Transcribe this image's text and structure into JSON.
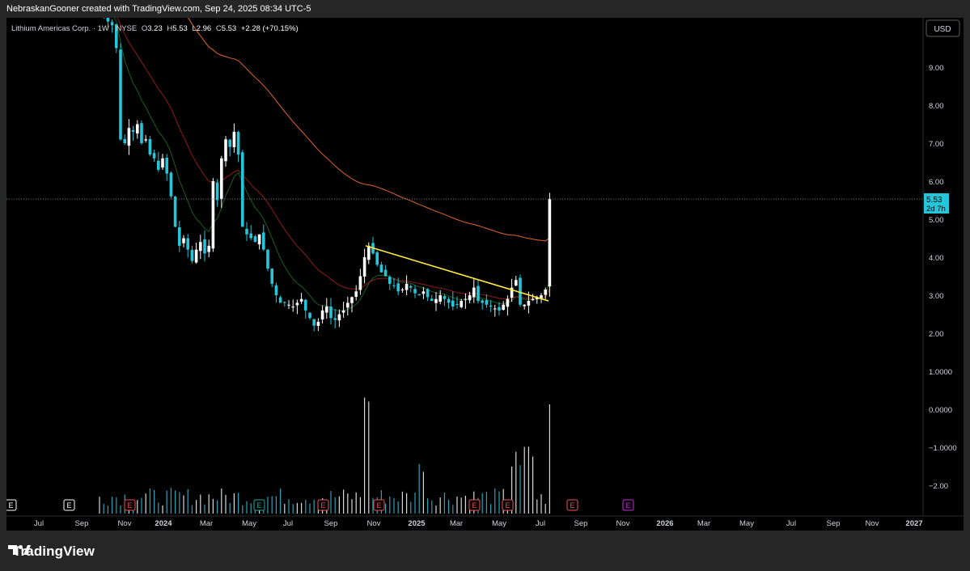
{
  "header": {
    "credit": "NebraskanGooner created with TradingView.com, Sep 24, 2025 08:34 UTC-5"
  },
  "legend": {
    "symbol": "Lithium Americas Corp. · 1W · NYSE",
    "o_label": "O",
    "o_value": "3.23",
    "h_label": "H",
    "h_value": "5.53",
    "l_label": "L",
    "l_value": "2.96",
    "c_label": "C",
    "c_value": "5.53",
    "change": "+2.28 (+70.15%)"
  },
  "currency_button": "USD",
  "price_axis_labels": [
    "9.00",
    "8.00",
    "7.00",
    "6.00",
    "5.00",
    "4.00",
    "3.00",
    "2.00",
    "1.0000",
    "0.0000",
    "−1.0000",
    "−2.00"
  ],
  "last_price": {
    "value": "5.53",
    "countdown": "2d 7h"
  },
  "time_axis_labels": [
    "Jul",
    "Sep",
    "Nov",
    "2024",
    "Mar",
    "May",
    "Jul",
    "Sep",
    "Nov",
    "2025",
    "Mar",
    "May",
    "Jul",
    "Sep",
    "Nov",
    "2026",
    "Mar",
    "May",
    "Jul",
    "Sep",
    "Nov",
    "2027"
  ],
  "earnings_marker_label": "E",
  "dividend_marker_label": "E",
  "brand": {
    "name": "TradingView"
  },
  "colors": {
    "background": "#000000",
    "up_candle": "#ffffff",
    "down_candle": "#26c6da",
    "ema_fast": "#1b5e20",
    "ema_mid": "#8e1b1b",
    "sma_slow": "#e0652a",
    "trendline": "#ffeb3b",
    "earnings": "#ef5350",
    "earnings_green": "#26a69a",
    "future_event": "#c62ad6",
    "volume": "#2aa0b8"
  },
  "chart_data": {
    "type": "candlestick",
    "interval": "1W",
    "price_range": [
      -2.6,
      10.4
    ],
    "x_labels": [
      "Jul",
      "Sep",
      "Nov",
      "2024",
      "Mar",
      "May",
      "Jul",
      "Sep",
      "Nov",
      "2025",
      "Mar",
      "May",
      "Jul",
      "Sep",
      "Nov",
      "2026",
      "Mar",
      "May",
      "Jul",
      "Sep",
      "Nov",
      "2027"
    ],
    "closes": [
      10.5,
      10.4,
      10.2,
      10.1,
      9.5,
      7.1,
      7.0,
      7.4,
      7.3,
      7.5,
      7.0,
      7.1,
      6.7,
      6.6,
      6.3,
      6.6,
      6.2,
      5.6,
      4.8,
      4.3,
      4.5,
      4.2,
      3.9,
      4.2,
      4.4,
      4.1,
      4.3,
      6.0,
      5.5,
      6.6,
      7.1,
      6.9,
      7.3,
      6.7,
      4.8,
      4.6,
      4.5,
      4.4,
      4.6,
      4.2,
      3.7,
      3.3,
      3.0,
      2.8,
      2.8,
      2.75,
      2.7,
      2.8,
      2.9,
      2.6,
      2.4,
      2.2,
      2.3,
      2.6,
      2.7,
      2.4,
      2.35,
      2.5,
      2.6,
      2.8,
      2.95,
      3.1,
      3.5,
      4.0,
      4.3,
      4.1,
      3.8,
      3.6,
      3.5,
      3.3,
      3.25,
      3.1,
      3.15,
      3.3,
      3.2,
      3.05,
      3.0,
      3.1,
      2.95,
      2.85,
      2.9,
      3.0,
      2.9,
      2.8,
      2.7,
      2.75,
      2.85,
      2.9,
      3.0,
      3.2,
      2.85,
      2.8,
      2.75,
      2.7,
      2.65,
      2.6,
      2.75,
      2.9,
      3.2,
      3.4,
      2.75,
      2.75,
      2.85,
      2.9,
      2.95,
      3.0,
      3.15,
      5.53
    ],
    "trendline": {
      "from": [
        "Oct 2024",
        4.3
      ],
      "to": [
        "Jul 2025",
        2.85
      ]
    },
    "indicators": [
      "EMA fast (green)",
      "EMA mid (red)",
      "SMA slow (orange)"
    ],
    "volume": "histogram under candles",
    "earnings_events": [
      "Aug 2023",
      "Nov 2023",
      "Feb 2024",
      "May 2024",
      "Aug 2024",
      "Nov 2024",
      "Mar 2025",
      "May 2025",
      "Aug 2025",
      "Nov 2025"
    ]
  }
}
